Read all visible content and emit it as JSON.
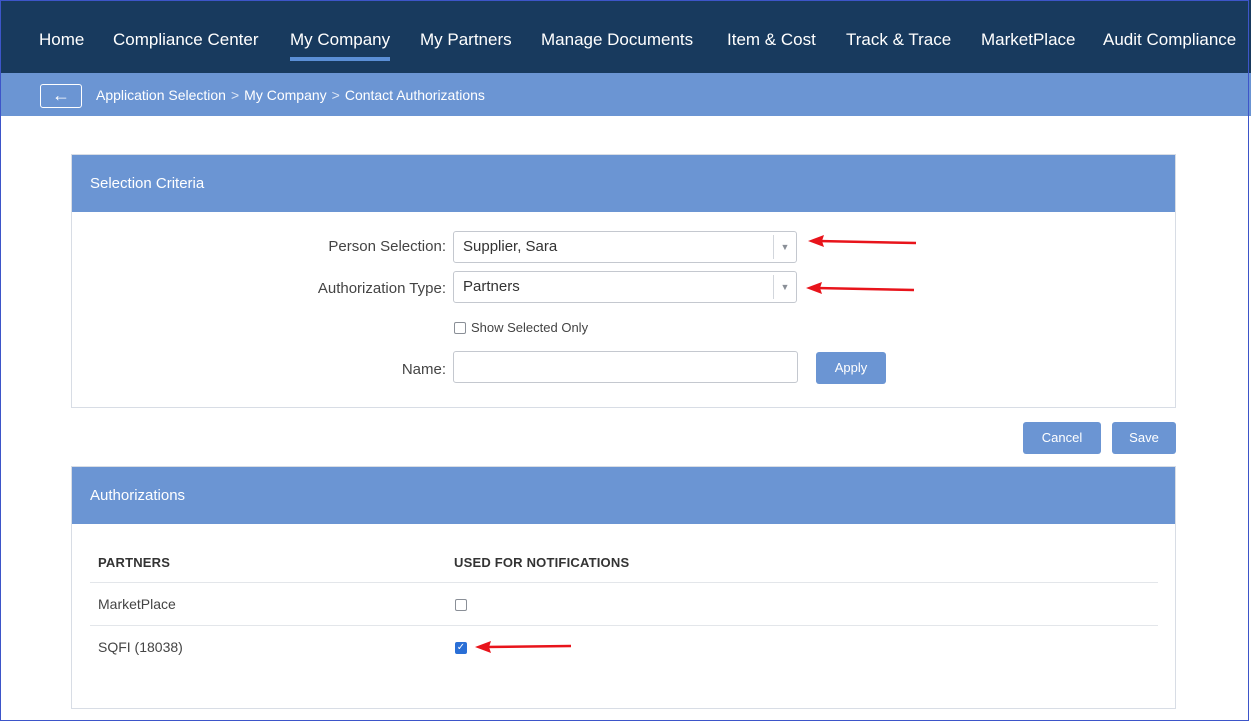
{
  "nav": {
    "items": [
      {
        "label": "Home",
        "active": false
      },
      {
        "label": "Compliance Center",
        "active": false
      },
      {
        "label": "My Company",
        "active": true
      },
      {
        "label": "My Partners",
        "active": false
      },
      {
        "label": "Manage Documents",
        "active": false
      },
      {
        "label": "Item & Cost",
        "active": false
      },
      {
        "label": "Track & Trace",
        "active": false
      },
      {
        "label": "MarketPlace",
        "active": false
      },
      {
        "label": "Audit Compliance",
        "active": false
      }
    ]
  },
  "breadcrumb": {
    "back_symbol": "←",
    "items": [
      "Application Selection",
      "My Company",
      "Contact Authorizations"
    ],
    "separator": ">"
  },
  "criteria": {
    "title": "Selection Criteria",
    "person_label": "Person Selection:",
    "person_value": "Supplier, Sara",
    "auth_type_label": "Authorization Type:",
    "auth_type_value": "Partners",
    "show_selected_label": "Show Selected Only",
    "show_selected_checked": false,
    "name_label": "Name:",
    "name_value": "",
    "apply_label": "Apply"
  },
  "actions": {
    "cancel_label": "Cancel",
    "save_label": "Save"
  },
  "authorizations": {
    "title": "Authorizations",
    "col_partners": "PARTNERS",
    "col_notifications": "USED FOR NOTIFICATIONS",
    "rows": [
      {
        "partner": "MarketPlace",
        "used_for_notifications": false
      },
      {
        "partner": "SQFI (18038)",
        "used_for_notifications": true
      }
    ]
  },
  "colors": {
    "nav_bg": "#183a5e",
    "accent": "#6b95d3",
    "annotation_arrow": "#e8141b",
    "checkbox_checked": "#2a6fd6"
  },
  "icons": {
    "back": "back-arrow-icon",
    "dropdown": "caret-down-icon",
    "check": "checkmark-icon",
    "annotation": "red-arrow-icon"
  }
}
